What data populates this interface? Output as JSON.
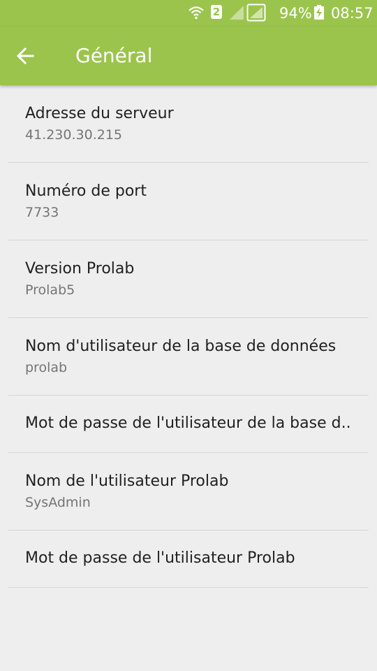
{
  "status_bar": {
    "sim_slot": "2",
    "battery": "94%",
    "time": "08:57"
  },
  "app_bar": {
    "title": "Général",
    "back_icon": "arrow-left-icon"
  },
  "colors": {
    "accent": "#9bc44d",
    "background": "#eeeeee",
    "title_text": "#212121",
    "summary_text": "#757575",
    "divider": "#d6d6d6"
  },
  "preferences": [
    {
      "title": "Adresse du serveur",
      "summary": "41.230.30.215"
    },
    {
      "title": "Numéro de port",
      "summary": "7733"
    },
    {
      "title": "Version Prolab",
      "summary": "Prolab5"
    },
    {
      "title": "Nom d'utilisateur de la base de données",
      "summary": "prolab"
    },
    {
      "title": "Mot de passe de l'utilisateur de la base d.."
    },
    {
      "title": "Nom de l'utilisateur Prolab",
      "summary": "SysAdmin"
    },
    {
      "title": "Mot de passe de l'utilisateur Prolab"
    }
  ]
}
